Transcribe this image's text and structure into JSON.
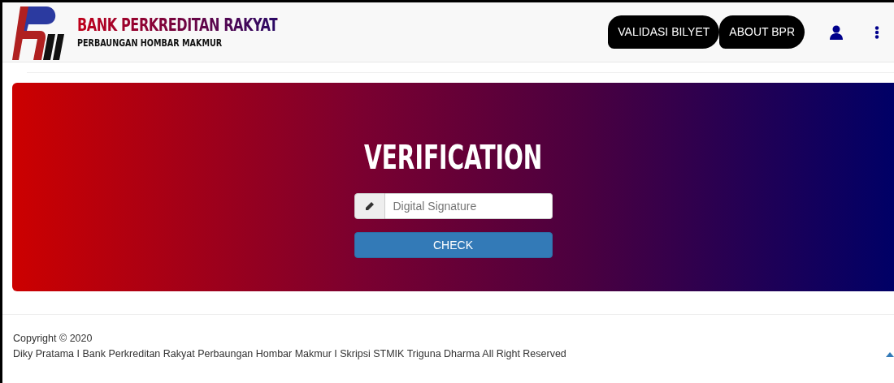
{
  "brand": {
    "title": "BANK PERKREDITAN RAKYAT",
    "subtitle": "PERBAUNGAN HOMBAR MAKMUR"
  },
  "nav_buttons": [
    "VALIDASI BILYET",
    "ABOUT BPR"
  ],
  "hero": {
    "title": "VERIFICATION",
    "input": {
      "placeholder": "Digital Signature"
    },
    "button": "CHECK"
  },
  "footer": {
    "copyright": "Copyright © 2020",
    "credits": "Diky Pratama I Bank Perkreditan Rakyat Perbaungan Hombar Makmur I Skripsi STMIK Triguna Dharma All Right Reserved"
  }
}
